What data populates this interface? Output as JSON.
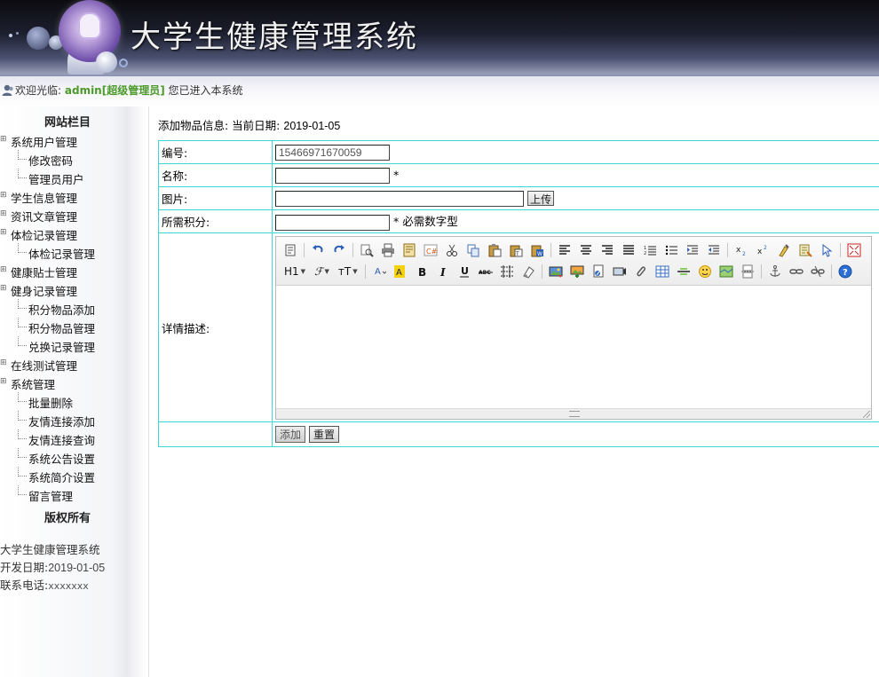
{
  "header": {
    "title": "大学生健康管理系统"
  },
  "welcome": {
    "prefix": "欢迎光临:",
    "username": "admin",
    "role": "[超级管理员]",
    "suffix": "您已进入本系统"
  },
  "sidebar": {
    "title": "网站栏目",
    "items": [
      {
        "label": "系统用户管理",
        "level": 1
      },
      {
        "label": "修改密码",
        "level": 2
      },
      {
        "label": "管理员用户",
        "level": 2
      },
      {
        "label": "学生信息管理",
        "level": 1
      },
      {
        "label": "资讯文章管理",
        "level": 1
      },
      {
        "label": "体检记录管理",
        "level": 1
      },
      {
        "label": "体检记录管理",
        "level": 2
      },
      {
        "label": "健康贴士管理",
        "level": 1
      },
      {
        "label": "健身记录管理",
        "level": 1
      },
      {
        "label": "积分物品添加",
        "level": 2
      },
      {
        "label": "积分物品管理",
        "level": 2
      },
      {
        "label": "兑换记录管理",
        "level": 2
      },
      {
        "label": "在线测试管理",
        "level": 1
      },
      {
        "label": "系统管理",
        "level": 1
      },
      {
        "label": "批量删除",
        "level": 2
      },
      {
        "label": "友情连接添加",
        "level": 2
      },
      {
        "label": "友情连接查询",
        "level": 2
      },
      {
        "label": "系统公告设置",
        "level": 2
      },
      {
        "label": "系统简介设置",
        "level": 2
      },
      {
        "label": "留言管理",
        "level": 2
      }
    ],
    "copyright_title": "版权所有",
    "footer": {
      "system_name": "大学生健康管理系统",
      "dev_date_label": "开发日期:",
      "dev_date": "2019-01-05",
      "phone_label": "联系电话:",
      "phone": "xxxxxxx"
    }
  },
  "main": {
    "heading_prefix": "添加物品信息: 当前日期:",
    "heading_date": "2019-01-05",
    "form": {
      "id_label": "编号:",
      "id_value": "15466971670059",
      "name_label": "名称:",
      "name_value": "",
      "name_required": "*",
      "image_label": "图片:",
      "image_value": "",
      "upload_button": "上传",
      "points_label": "所需积分:",
      "points_value": "",
      "points_hint": "* 必需数字型",
      "detail_label": "详情描述:",
      "submit_button": "添加",
      "reset_button": "重置"
    },
    "editor_toolbar": {
      "heading_drop": "H1",
      "font_drop": "ℱ",
      "size_drop": "ᴛT",
      "row1_icons": [
        "source-icon",
        "undo-icon",
        "redo-icon",
        "preview-icon",
        "print-icon",
        "template-icon",
        "code-icon",
        "cut-icon",
        "copy-icon",
        "paste-icon",
        "paste-text-icon",
        "paste-word-icon",
        "align-left-icon",
        "align-center-icon",
        "align-right-icon",
        "justify-icon",
        "ordered-list-icon",
        "unordered-list-icon",
        "indent-icon",
        "outdent-icon",
        "subscript-icon",
        "superscript-icon",
        "clear-format-icon",
        "select-all-icon",
        "cursor-icon",
        "fullscreen-icon"
      ],
      "row2_icons": [
        "forecolor-icon",
        "hilitecolor-icon",
        "bold-icon",
        "italic-icon",
        "underline-icon",
        "strikethrough-icon",
        "line-height-icon",
        "remove-format-icon",
        "image-icon",
        "multi-image-icon",
        "flash-icon",
        "media-icon",
        "attachment-icon",
        "table-icon",
        "hr-icon",
        "emoticon-icon",
        "baidumap-icon",
        "pagebreak-icon",
        "anchor-icon",
        "link-icon",
        "unlink-icon",
        "help-icon"
      ]
    }
  }
}
